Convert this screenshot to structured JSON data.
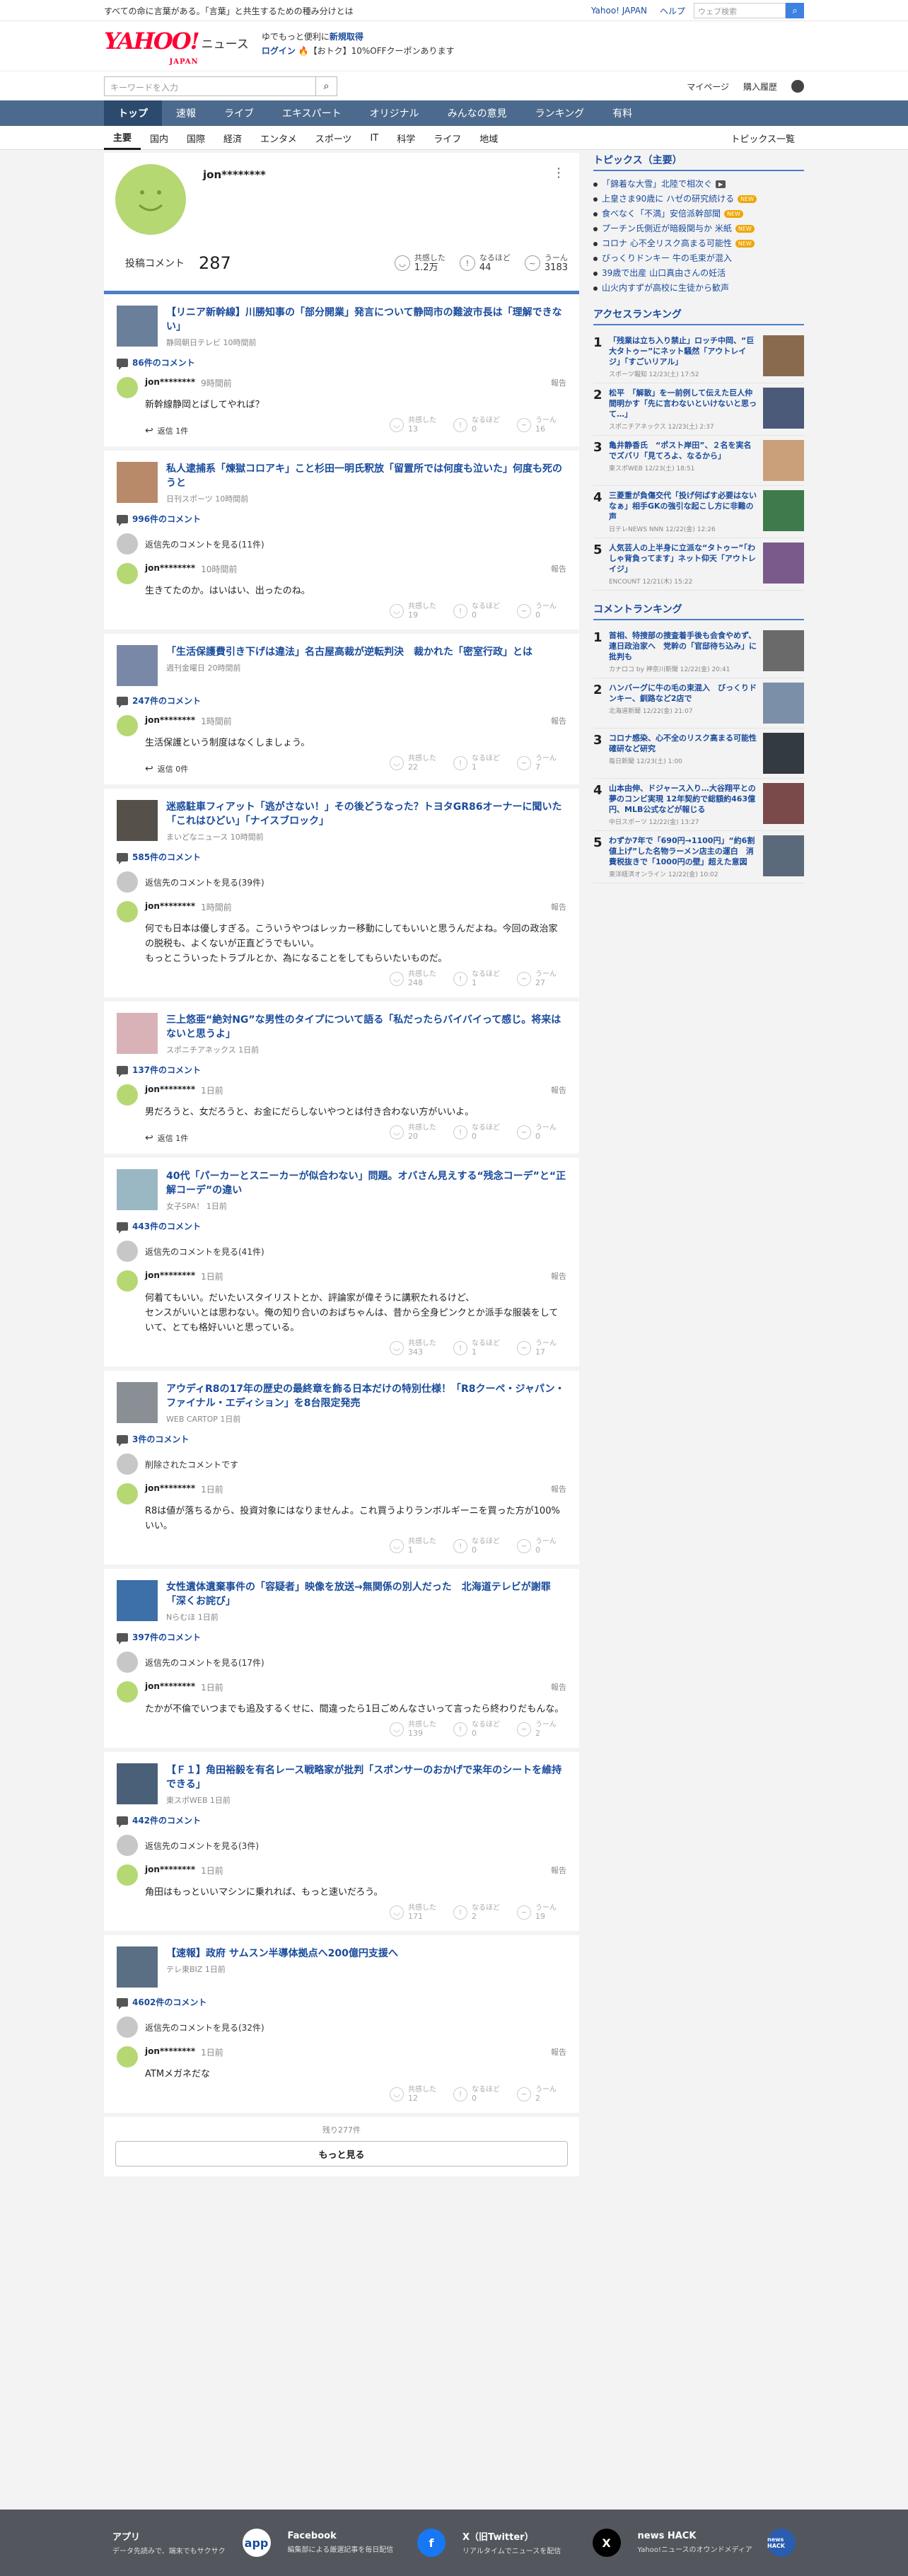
{
  "header": {
    "notice": "すべての命に言葉がある。「言葉」と共生するための種み分けとは",
    "links": [
      "Yahoo! JAPAN",
      "ヘルプ"
    ],
    "search_placeholder": "ウェブ検索",
    "logo": "YAHOO!",
    "logo_sub": "JAPAN",
    "brand": "ニュース",
    "promo_line1_a": "ゆでもっと便利に",
    "promo_line1_b": "新規取得",
    "promo_login": "ログイン",
    "promo_line2": "【おトク】10%OFFクーポンあります",
    "keyword_placeholder": "キーワードを入力",
    "mypage": "マイページ",
    "history": "購入履歴"
  },
  "mainnav": [
    "トップ",
    "速報",
    "ライブ",
    "エキスパート",
    "オリジナル",
    "みんなの意見",
    "ランキング",
    "有料"
  ],
  "subnav": [
    "主要",
    "国内",
    "国際",
    "経済",
    "エンタメ",
    "スポーツ",
    "IT",
    "科学",
    "ライフ",
    "地域"
  ],
  "subnav_right": "トピックス一覧",
  "profile": {
    "name": "jon********",
    "label": "投稿コメント",
    "count": "287",
    "stats": [
      {
        "name": "共感した",
        "value": "1.2万"
      },
      {
        "name": "なるほど",
        "value": "44"
      },
      {
        "name": "うーん",
        "value": "3183"
      }
    ]
  },
  "reaction_labels": [
    "共感した",
    "なるほど",
    "うーん"
  ],
  "cards": [
    {
      "title": "【リニア新幹線】川勝知事の「部分開業」発言について静岡市の難波市長は「理解できない」",
      "source": "静岡朝日テレビ 10時間前",
      "count": "86件のコメント",
      "other": "",
      "time": "9時間前",
      "text": "新幹線静岡とばしてやれば？",
      "r": [
        "13",
        "0",
        "16"
      ],
      "reply": "返信 1件"
    },
    {
      "title": "私人逮捕系「煉獄コロアキ」こと杉田一明氏釈放「留置所では何度も泣いた」何度も死のうと",
      "source": "日刊スポーツ 10時間前",
      "count": "996件のコメント",
      "other": "返信先のコメントを見る(11件)",
      "time": "10時間前",
      "text": "生きてたのか。はいはい、出ったのね。",
      "r": [
        "19",
        "0",
        "0"
      ],
      "reply": ""
    },
    {
      "title": "「生活保護費引き下げは違法」名古屋高裁が逆転判決　裁かれた「密室行政」とは",
      "source": "週刊金曜日 20時間前",
      "count": "247件のコメント",
      "other": "",
      "time": "1時間前",
      "text": "生活保護という制度はなくしましょう。",
      "r": [
        "22",
        "1",
        "7"
      ],
      "reply": "返信 0件"
    },
    {
      "title": "迷惑駐車フィアット「逃がさない！」その後どうなった？トヨタGR86オーナーに聞いた「これはひどい」「ナイスブロック」",
      "source": "まいどなニュース 10時間前",
      "count": "585件のコメント",
      "other": "返信先のコメントを見る(39件)",
      "time": "1時間前",
      "text": "何でも日本は優しすぎる。こういうやつはレッカー移動にしてもいいと思うんだよね。今回の政治家の脱税も、よくないが正直どうでもいい。\nもっとこういったトラブルとか、為になることをしてもらいたいものだ。",
      "r": [
        "248",
        "1",
        "27"
      ],
      "reply": ""
    },
    {
      "title": "三上悠亜“絶対NG”な男性のタイプについて語る「私だったらバイバイって感じ。将来はないと思うよ」",
      "source": "スポニチアネックス 1日前",
      "count": "137件のコメント",
      "other": "",
      "time": "1日前",
      "text": "男だろうと、女だろうと、お金にだらしないやつとは付き合わない方がいいよ。",
      "r": [
        "20",
        "0",
        "0"
      ],
      "reply": "返信 1件"
    },
    {
      "title": "40代「パーカーとスニーカーが似合わない」問題。オバさん見えする“残念コーデ”と“正解コーデ”の違い",
      "source": "女子SPA！ 1日前",
      "count": "443件のコメント",
      "other": "返信先のコメントを見る(41件)",
      "time": "1日前",
      "text": "何着てもいい。だいたいスタイリストとか、評論家が偉そうに講釈たれるけど、\nセンスがいいとは思わない。俺の知り合いのおばちゃんは、昔から全身ピンクとか派手な服装をしていて、とても格好いいと思っている。",
      "r": [
        "343",
        "1",
        "17"
      ],
      "reply": ""
    },
    {
      "title": "アウディR8の17年の歴史の最終章を飾る日本だけの特別仕様！「R8クーペ・ジャパン・ファイナル・エディション」を8台限定発売",
      "source": "WEB CARTOP 1日前",
      "count": "3件のコメント",
      "other": "削除されたコメントです",
      "time": "1日前",
      "text": "R8は値が落ちるから、投資対象にはなりませんよ。これ買うよりランボルギーニを買った方が100%いい。",
      "r": [
        "1",
        "0",
        "0"
      ],
      "reply": ""
    },
    {
      "title": "女性遺体遺棄事件の「容疑者」映像を放送→無関係の別人だった　北海道テレビが謝罪「深くお詫び」",
      "source": "Nらむほ 1日前",
      "count": "397件のコメント",
      "other": "返信先のコメントを見る(17件)",
      "time": "1日前",
      "text": "たかが不倫でいつまでも追及するくせに、間違ったら1日ごめんなさいって言ったら終わりだもんな。",
      "r": [
        "139",
        "0",
        "2"
      ],
      "reply": ""
    },
    {
      "title": "【Ｆ１】角田裕毅を有名レース戦略家が批判「スポンサーのおかげで来年のシートを維持できる」",
      "source": "東スポWEB 1日前",
      "count": "442件のコメント",
      "other": "返信先のコメントを見る(3件)",
      "time": "1日前",
      "text": "角田はもっといいマシンに乗れれば、もっと速いだろう。",
      "r": [
        "171",
        "2",
        "19"
      ],
      "reply": ""
    },
    {
      "title": "【速報】政府 サムスン半導体拠点へ200億円支援へ",
      "source": "テレ東BIZ 1日前",
      "count": "4602件のコメント",
      "other": "返信先のコメントを見る(32件)",
      "time": "1日前",
      "text": "ATMメガネだな",
      "r": [
        "12",
        "0",
        "2"
      ],
      "reply": ""
    }
  ],
  "profile_name_short": "jon********",
  "report": "報告",
  "more": {
    "remaining": "残り277件",
    "button": "もっと見る"
  },
  "sidebar": {
    "topics_title": "トピックス（主要）",
    "topics": [
      {
        "t": "「錦着な大雪」北陸で相次ぐ",
        "b": "cam"
      },
      {
        "t": "上皇さま90歳に ハゼの研究続ける",
        "b": "NEW"
      },
      {
        "t": "食べなく「不満」安倍派幹部聞",
        "b": "NEW"
      },
      {
        "t": "プーチン氏側近が暗殺関与か 米紙",
        "b": "NEW"
      },
      {
        "t": "コロナ 心不全リスク高まる可能性",
        "b": "NEW"
      },
      {
        "t": "びっくりドンキー 牛の毛束が混入",
        "b": ""
      },
      {
        "t": "39歳で出産 山口真由さんの妊活",
        "b": ""
      },
      {
        "t": "山火内すずが高校に生徒から歓声",
        "b": ""
      }
    ],
    "access_title": "アクセスランキング",
    "access": [
      {
        "t": "「残業は立ち入り禁止」ロッチ中岡、“巨大タトゥー”にネット騒然「アウトレイジ」「すごいリアル」",
        "s": "スポーツ報知 12/23(土) 17:52"
      },
      {
        "t": "松平　「解散」を一前例して伝えた巨人仲間明かす「先に言わないといけないと思って…」",
        "s": "スポニチアネックス 12/23(土) 2:37"
      },
      {
        "t": "亀井静香氏　“ポスト岸田”、２名を実名でズバリ「見てろよ、なるから」",
        "s": "東スポWEB 12/23(土) 18:51"
      },
      {
        "t": "三菱重が負傷交代「投げ何ばす必要はないなぁ」相手GKの強引な起こし方に非難の声",
        "s": "日テレNEWS NNN 12/22(金) 12:26"
      },
      {
        "t": "人気芸人の上半身に立派な“タトゥー”「わしゃ背負ってます」ネット仰天「アウトレイジ」",
        "s": "ENCOUNT 12/21(木) 15:22"
      }
    ],
    "comment_title": "コメントランキング",
    "comments": [
      {
        "t": "首相、特捜部の捜査着手後も会食やめず、連日政治家へ　党幹の「官邸待ち込み」に批判も",
        "s": "カナロコ by 神奈川新聞 12/22(金) 20:41"
      },
      {
        "t": "ハンバーグに牛の毛の束混入　びっくりドンキー、釧路など2店で",
        "s": "北海道新聞 12/22(金) 21:07"
      },
      {
        "t": "コロナ感染、心不全のリスク高まる可能性　確研など研究",
        "s": "毎日新聞 12/23(土) 1:00"
      },
      {
        "t": "山本由伸、ドジャース入り…大谷翔平との夢のコンビ実現 12年契約で総額約463億円、MLB公式などが報じる",
        "s": "中日スポーツ 12/22(金) 13:27"
      },
      {
        "t": "わずか7年で「690円→1100円」“約6割値上げ”した名物ラーメン店主の運白　消費税抜きで「1000円の壁」超えた意図",
        "s": "東洋経済オンライン 12/22(金) 10:02"
      }
    ]
  },
  "footer": [
    {
      "t": "アプリ",
      "d": "データ先読みで、端末でもサクサク",
      "i": "app"
    },
    {
      "t": "Facebook",
      "d": "編集部による厳選記事を毎日配信",
      "i": "f"
    },
    {
      "t": "X（旧Twitter）",
      "d": "リアルタイムでニュースを配信",
      "i": "X"
    },
    {
      "t": "news HACK",
      "d": "Yahoo!ニュースのオウンドメディア",
      "i": "news HACK"
    }
  ],
  "colors": {
    "accent": "#1a4b9c",
    "nav": "#4c6a8e",
    "avatar": "#b5d873",
    "badge": "#f0a500"
  }
}
